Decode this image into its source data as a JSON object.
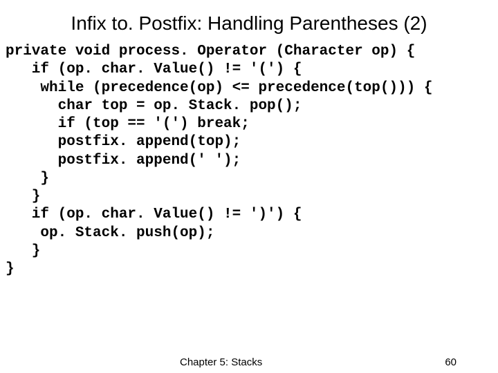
{
  "title": "Infix to. Postfix: Handling Parentheses (2)",
  "code": "private void process. Operator (Character op) {\n   if (op. char. Value() != '(') {\n    while (precedence(op) <= precedence(top())) {\n      char top = op. Stack. pop();\n      if (top == '(') break;\n      postfix. append(top);\n      postfix. append(' ');\n    }\n   }\n   if (op. char. Value() != ')') {\n    op. Stack. push(op);\n   }\n}",
  "footer": {
    "chapter": "Chapter 5: Stacks",
    "page": "60"
  }
}
